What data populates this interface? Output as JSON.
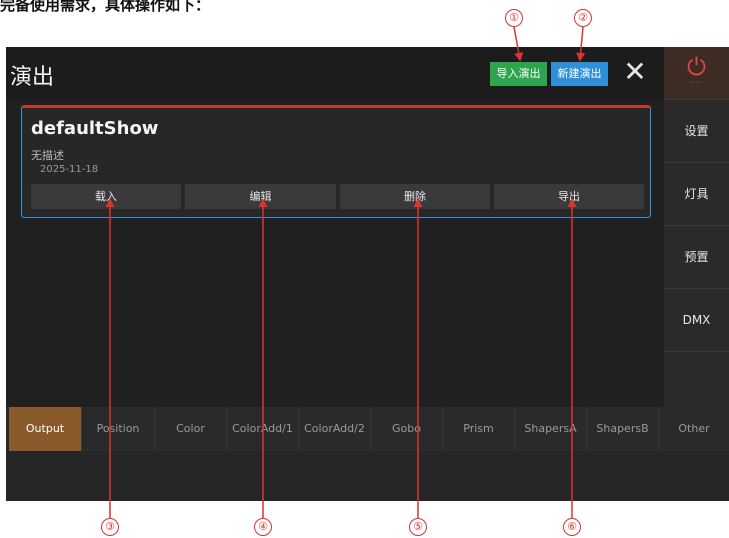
{
  "top_text": "完备使用需求，具体操作如下：",
  "header": {
    "title": "演出",
    "import_label": "导入演出",
    "new_label": "新建演出",
    "close_glyph": "✕"
  },
  "sidebar": {
    "power_dots": "...",
    "items": [
      {
        "label": "设置"
      },
      {
        "label": "灯具"
      },
      {
        "label": "预置"
      },
      {
        "label": "DMX"
      },
      {
        "label": ""
      }
    ]
  },
  "show_card": {
    "name": "defaultShow",
    "description": "无描述",
    "date": "2025-11-18",
    "buttons": [
      "载入",
      "编辑",
      "删除",
      "导出"
    ]
  },
  "tabs": [
    {
      "label": "Output",
      "active": true
    },
    {
      "label": "Position"
    },
    {
      "label": "Color"
    },
    {
      "label": "ColorAdd/1"
    },
    {
      "label": "ColorAdd/2"
    },
    {
      "label": "Gobo"
    },
    {
      "label": "Prism"
    },
    {
      "label": "ShapersA"
    },
    {
      "label": "ShapersB"
    },
    {
      "label": "Other"
    }
  ],
  "markers": [
    "①",
    "②",
    "③",
    "④",
    "⑤",
    "⑥"
  ],
  "colors": {
    "import": "#2ea44f",
    "new": "#2f8fd8",
    "active_tab": "#8a5a2b",
    "power": "#e04444",
    "annotation": "#dd3333"
  }
}
